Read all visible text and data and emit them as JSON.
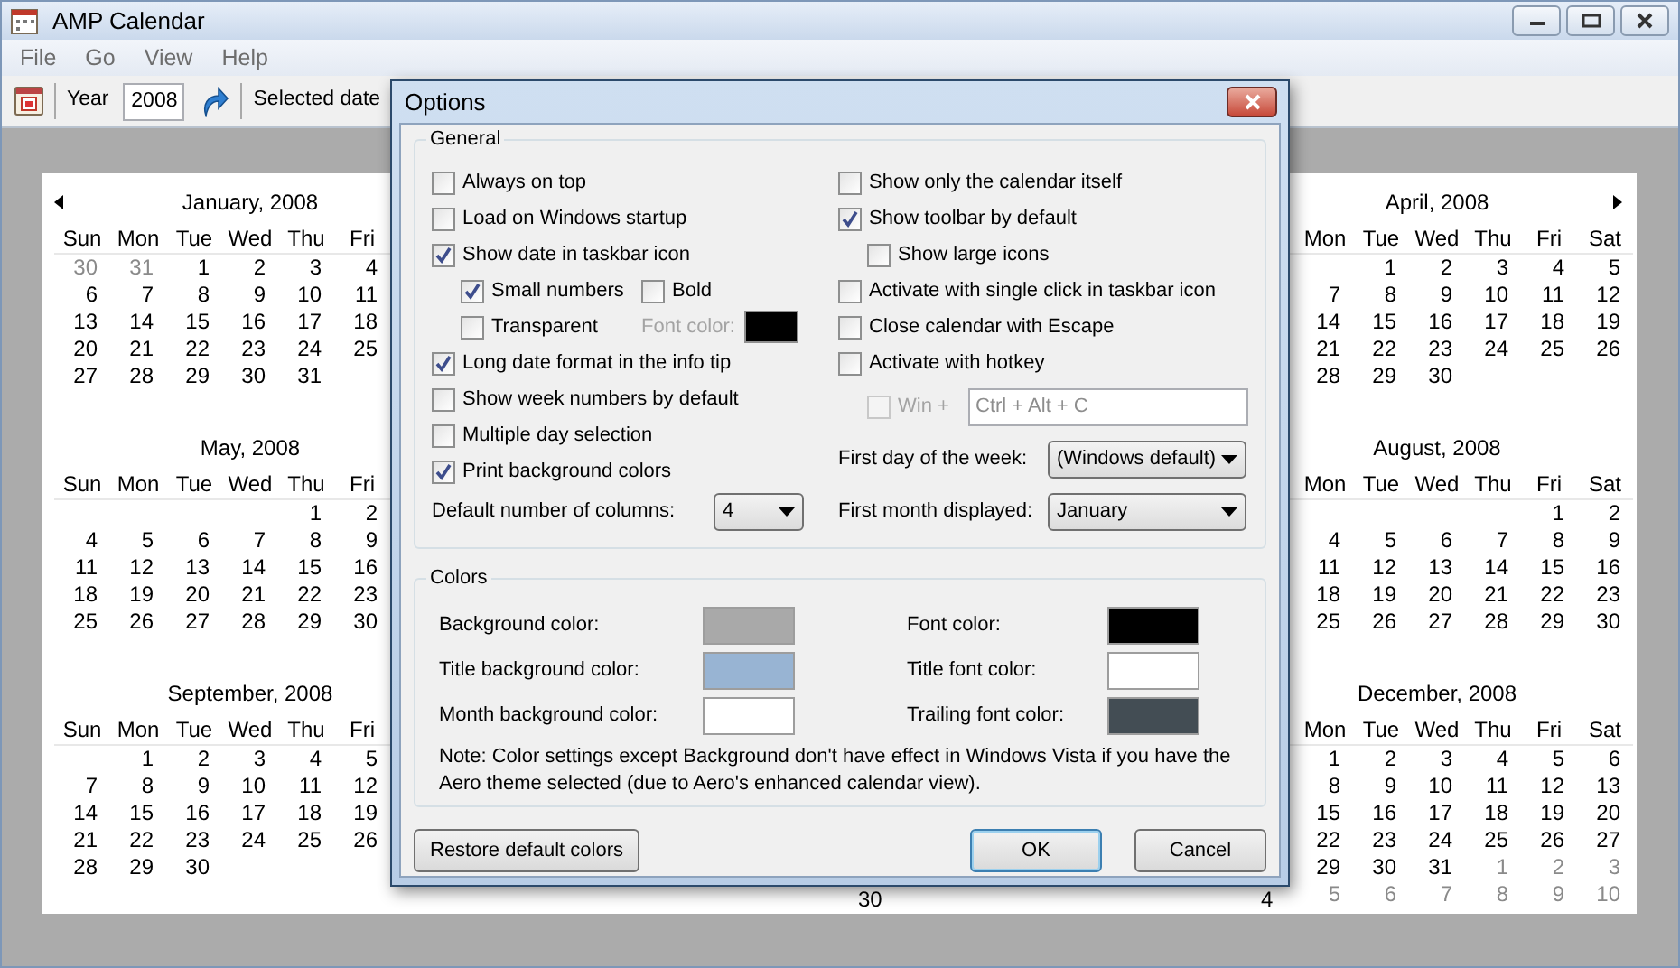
{
  "window": {
    "title": "AMP Calendar"
  },
  "menu": [
    "File",
    "Go",
    "View",
    "Help"
  ],
  "toolbar": {
    "year_label": "Year",
    "year_value": "2008",
    "selected_date_label": "Selected date"
  },
  "calendar": {
    "left_months": [
      {
        "title": "January, 2008",
        "days": [
          "Sun",
          "Mon",
          "Tue",
          "Wed",
          "Thu",
          "Fri"
        ],
        "weeks": [
          [
            {
              "d": "30",
              "trailing": true
            },
            {
              "d": "31",
              "trailing": true
            },
            {
              "d": "1",
              "trailing": false
            },
            {
              "d": "2",
              "trailing": false
            },
            {
              "d": "3",
              "trailing": false
            },
            {
              "d": "4",
              "trailing": false
            }
          ],
          [
            {
              "d": "6",
              "trailing": false
            },
            {
              "d": "7",
              "trailing": false
            },
            {
              "d": "8",
              "trailing": false
            },
            {
              "d": "9",
              "trailing": false
            },
            {
              "d": "10",
              "trailing": false
            },
            {
              "d": "11",
              "trailing": false
            }
          ],
          [
            {
              "d": "13",
              "trailing": false
            },
            {
              "d": "14",
              "trailing": false
            },
            {
              "d": "15",
              "trailing": false
            },
            {
              "d": "16",
              "trailing": false
            },
            {
              "d": "17",
              "trailing": false
            },
            {
              "d": "18",
              "trailing": false
            }
          ],
          [
            {
              "d": "20",
              "trailing": false
            },
            {
              "d": "21",
              "trailing": false
            },
            {
              "d": "22",
              "trailing": false
            },
            {
              "d": "23",
              "trailing": false
            },
            {
              "d": "24",
              "trailing": false
            },
            {
              "d": "25",
              "trailing": false
            }
          ],
          [
            {
              "d": "27",
              "trailing": false
            },
            {
              "d": "28",
              "trailing": false
            },
            {
              "d": "29",
              "trailing": false
            },
            {
              "d": "30",
              "trailing": false
            },
            {
              "d": "31",
              "trailing": false
            }
          ]
        ]
      },
      {
        "title": "May, 2008",
        "days": [
          "Sun",
          "Mon",
          "Tue",
          "Wed",
          "Thu",
          "Fri"
        ],
        "weeks": [
          [
            {
              "d": "1",
              "trailing": false
            },
            {
              "d": "2",
              "trailing": false
            }
          ],
          [
            {
              "d": "4",
              "trailing": false
            },
            {
              "d": "5",
              "trailing": false
            },
            {
              "d": "6",
              "trailing": false
            },
            {
              "d": "7",
              "trailing": false
            },
            {
              "d": "8",
              "trailing": false
            },
            {
              "d": "9",
              "trailing": false
            }
          ],
          [
            {
              "d": "11",
              "trailing": false
            },
            {
              "d": "12",
              "trailing": false
            },
            {
              "d": "13",
              "trailing": false
            },
            {
              "d": "14",
              "trailing": false
            },
            {
              "d": "15",
              "trailing": false
            },
            {
              "d": "16",
              "trailing": false
            }
          ],
          [
            {
              "d": "18",
              "trailing": false
            },
            {
              "d": "19",
              "trailing": false
            },
            {
              "d": "20",
              "trailing": false
            },
            {
              "d": "21",
              "trailing": false
            },
            {
              "d": "22",
              "trailing": false
            },
            {
              "d": "23",
              "trailing": false
            }
          ],
          [
            {
              "d": "25",
              "trailing": false
            },
            {
              "d": "26",
              "trailing": false
            },
            {
              "d": "27",
              "trailing": false
            },
            {
              "d": "28",
              "trailing": false
            },
            {
              "d": "29",
              "trailing": false
            },
            {
              "d": "30",
              "trailing": false
            }
          ]
        ]
      },
      {
        "title": "September, 2008",
        "days": [
          "Sun",
          "Mon",
          "Tue",
          "Wed",
          "Thu",
          "Fri"
        ],
        "weeks": [
          [
            {
              "d": "1",
              "trailing": false
            },
            {
              "d": "2",
              "trailing": false
            },
            {
              "d": "3",
              "trailing": false
            },
            {
              "d": "4",
              "trailing": false
            },
            {
              "d": "5",
              "trailing": false
            }
          ],
          [
            {
              "d": "7",
              "trailing": false
            },
            {
              "d": "8",
              "trailing": false
            },
            {
              "d": "9",
              "trailing": false
            },
            {
              "d": "10",
              "trailing": false
            },
            {
              "d": "11",
              "trailing": false
            },
            {
              "d": "12",
              "trailing": false
            }
          ],
          [
            {
              "d": "14",
              "trailing": false
            },
            {
              "d": "15",
              "trailing": false
            },
            {
              "d": "16",
              "trailing": false
            },
            {
              "d": "17",
              "trailing": false
            },
            {
              "d": "18",
              "trailing": false
            },
            {
              "d": "19",
              "trailing": false
            }
          ],
          [
            {
              "d": "21",
              "trailing": false
            },
            {
              "d": "22",
              "trailing": false
            },
            {
              "d": "23",
              "trailing": false
            },
            {
              "d": "24",
              "trailing": false
            },
            {
              "d": "25",
              "trailing": false
            },
            {
              "d": "26",
              "trailing": false
            }
          ],
          [
            {
              "d": "28",
              "trailing": false
            },
            {
              "d": "29",
              "trailing": false
            },
            {
              "d": "30",
              "trailing": false
            }
          ]
        ]
      }
    ],
    "right_months": [
      {
        "title": "April, 2008",
        "days": [
          "Mon",
          "Tue",
          "Wed",
          "Thu",
          "Fri",
          "Sat"
        ],
        "weeks": [
          [
            {
              "d": "1",
              "trailing": false
            },
            {
              "d": "2",
              "trailing": false
            },
            {
              "d": "3",
              "trailing": false
            },
            {
              "d": "4",
              "trailing": false
            },
            {
              "d": "5",
              "trailing": false
            }
          ],
          [
            {
              "d": "7",
              "trailing": false
            },
            {
              "d": "8",
              "trailing": false
            },
            {
              "d": "9",
              "trailing": false
            },
            {
              "d": "10",
              "trailing": false
            },
            {
              "d": "11",
              "trailing": false
            },
            {
              "d": "12",
              "trailing": false
            }
          ],
          [
            {
              "d": "14",
              "trailing": false
            },
            {
              "d": "15",
              "trailing": false
            },
            {
              "d": "16",
              "trailing": false
            },
            {
              "d": "17",
              "trailing": false
            },
            {
              "d": "18",
              "trailing": false
            },
            {
              "d": "19",
              "trailing": false
            }
          ],
          [
            {
              "d": "21",
              "trailing": false
            },
            {
              "d": "22",
              "trailing": false
            },
            {
              "d": "23",
              "trailing": false
            },
            {
              "d": "24",
              "trailing": false
            },
            {
              "d": "25",
              "trailing": false
            },
            {
              "d": "26",
              "trailing": false
            }
          ],
          [
            {
              "d": "28",
              "trailing": false
            },
            {
              "d": "29",
              "trailing": false
            },
            {
              "d": "30",
              "trailing": false
            }
          ]
        ]
      },
      {
        "title": "August, 2008",
        "days": [
          "Mon",
          "Tue",
          "Wed",
          "Thu",
          "Fri",
          "Sat"
        ],
        "weeks": [
          [
            {
              "d": "1",
              "trailing": false
            },
            {
              "d": "2",
              "trailing": false
            }
          ],
          [
            {
              "d": "4",
              "trailing": false
            },
            {
              "d": "5",
              "trailing": false
            },
            {
              "d": "6",
              "trailing": false
            },
            {
              "d": "7",
              "trailing": false
            },
            {
              "d": "8",
              "trailing": false
            },
            {
              "d": "9",
              "trailing": false
            }
          ],
          [
            {
              "d": "11",
              "trailing": false
            },
            {
              "d": "12",
              "trailing": false
            },
            {
              "d": "13",
              "trailing": false
            },
            {
              "d": "14",
              "trailing": false
            },
            {
              "d": "15",
              "trailing": false
            },
            {
              "d": "16",
              "trailing": false
            }
          ],
          [
            {
              "d": "18",
              "trailing": false
            },
            {
              "d": "19",
              "trailing": false
            },
            {
              "d": "20",
              "trailing": false
            },
            {
              "d": "21",
              "trailing": false
            },
            {
              "d": "22",
              "trailing": false
            },
            {
              "d": "23",
              "trailing": false
            }
          ],
          [
            {
              "d": "25",
              "trailing": false
            },
            {
              "d": "26",
              "trailing": false
            },
            {
              "d": "27",
              "trailing": false
            },
            {
              "d": "28",
              "trailing": false
            },
            {
              "d": "29",
              "trailing": false
            },
            {
              "d": "30",
              "trailing": false
            }
          ]
        ]
      },
      {
        "title": "December, 2008",
        "days": [
          "Mon",
          "Tue",
          "Wed",
          "Thu",
          "Fri",
          "Sat"
        ],
        "weeks": [
          [
            {
              "d": "1",
              "trailing": false
            },
            {
              "d": "2",
              "trailing": false
            },
            {
              "d": "3",
              "trailing": false
            },
            {
              "d": "4",
              "trailing": false
            },
            {
              "d": "5",
              "trailing": false
            },
            {
              "d": "6",
              "trailing": false
            }
          ],
          [
            {
              "d": "8",
              "trailing": false
            },
            {
              "d": "9",
              "trailing": false
            },
            {
              "d": "10",
              "trailing": false
            },
            {
              "d": "11",
              "trailing": false
            },
            {
              "d": "12",
              "trailing": false
            },
            {
              "d": "13",
              "trailing": false
            }
          ],
          [
            {
              "d": "15",
              "trailing": false
            },
            {
              "d": "16",
              "trailing": false
            },
            {
              "d": "17",
              "trailing": false
            },
            {
              "d": "18",
              "trailing": false
            },
            {
              "d": "19",
              "trailing": false
            },
            {
              "d": "20",
              "trailing": false
            }
          ],
          [
            {
              "d": "22",
              "trailing": false
            },
            {
              "d": "23",
              "trailing": false
            },
            {
              "d": "24",
              "trailing": false
            },
            {
              "d": "25",
              "trailing": false
            },
            {
              "d": "26",
              "trailing": false
            },
            {
              "d": "27",
              "trailing": false
            }
          ],
          [
            {
              "d": "29",
              "trailing": false
            },
            {
              "d": "30",
              "trailing": false
            },
            {
              "d": "31",
              "trailing": false
            },
            {
              "d": "1",
              "trailing": true
            },
            {
              "d": "2",
              "trailing": true
            },
            {
              "d": "3",
              "trailing": true
            }
          ],
          [
            {
              "d": "5",
              "trailing": true
            },
            {
              "d": "6",
              "trailing": true
            },
            {
              "d": "7",
              "trailing": true
            },
            {
              "d": "8",
              "trailing": true
            },
            {
              "d": "9",
              "trailing": true
            },
            {
              "d": "10",
              "trailing": true
            }
          ]
        ]
      }
    ],
    "fragments": [
      {
        "d": "30"
      },
      {
        "d": "4"
      }
    ]
  },
  "dialog": {
    "title": "Options",
    "general": {
      "legend": "General",
      "left": [
        {
          "kind": "checkbox",
          "label": "Always on top",
          "checked": false
        },
        {
          "kind": "checkbox",
          "label": "Load on Windows startup",
          "checked": false
        },
        {
          "kind": "checkbox",
          "label": "Show date in taskbar icon",
          "checked": true,
          "children": [
            {
              "kind": "checkbox_row",
              "items": [
                {
                  "label": "Small numbers",
                  "checked": true
                },
                {
                  "label": "Bold",
                  "checked": false
                }
              ]
            },
            {
              "kind": "checkbox_row",
              "items": [
                {
                  "label": "Transparent",
                  "checked": false
                }
              ],
              "color_label": "Font color:",
              "color_label_disabled": true,
              "color": "#000000"
            }
          ]
        },
        {
          "kind": "checkbox",
          "label": "Long date format in the info tip",
          "checked": true
        },
        {
          "kind": "checkbox",
          "label": "Show week numbers by default",
          "checked": false
        },
        {
          "kind": "checkbox",
          "label": "Multiple day selection",
          "checked": false
        },
        {
          "kind": "checkbox",
          "label": "Print background colors",
          "checked": true
        },
        {
          "kind": "select",
          "label": "Default number of columns:",
          "value": "4"
        }
      ],
      "right": [
        {
          "kind": "checkbox",
          "label": "Show only the calendar itself",
          "checked": false
        },
        {
          "kind": "checkbox",
          "label": "Show toolbar by default",
          "checked": true,
          "children": [
            {
              "kind": "checkbox",
              "label": "Show large icons",
              "checked": false
            }
          ]
        },
        {
          "kind": "checkbox",
          "label": "Activate with single click in taskbar icon",
          "checked": false
        },
        {
          "kind": "checkbox",
          "label": "Close calendar with Escape",
          "checked": false
        },
        {
          "kind": "checkbox",
          "label": "Activate with hotkey",
          "checked": false,
          "children": [
            {
              "kind": "hotkey",
              "label": "Win +",
              "checked": false,
              "disabled": true,
              "value": "Ctrl + Alt + C"
            }
          ]
        },
        {
          "kind": "select",
          "label": "First day of the week:",
          "value": "(Windows default)"
        },
        {
          "kind": "select",
          "label": "First month displayed:",
          "value": "January"
        }
      ]
    },
    "colors": {
      "legend": "Colors",
      "left": [
        {
          "label": "Background color:",
          "color": "#a9a9a9"
        },
        {
          "label": "Title background color:",
          "color": "#98b4d3"
        },
        {
          "label": "Month background color:",
          "color": "#ffffff"
        }
      ],
      "right": [
        {
          "label": "Font color:",
          "color": "#000000"
        },
        {
          "label": "Title font color:",
          "color": "#ffffff"
        },
        {
          "label": "Trailing font color:",
          "color": "#434d54"
        }
      ],
      "note": "Note: Color settings except Background don't have effect in Windows Vista if you have the Aero theme selected (due to Aero's enhanced calendar view)."
    },
    "buttons": [
      {
        "kind": "restore",
        "label": "Restore default colors",
        "default": false
      },
      {
        "kind": "ok",
        "label": "OK",
        "default": true
      },
      {
        "kind": "cancel",
        "label": "Cancel",
        "default": false
      }
    ]
  }
}
